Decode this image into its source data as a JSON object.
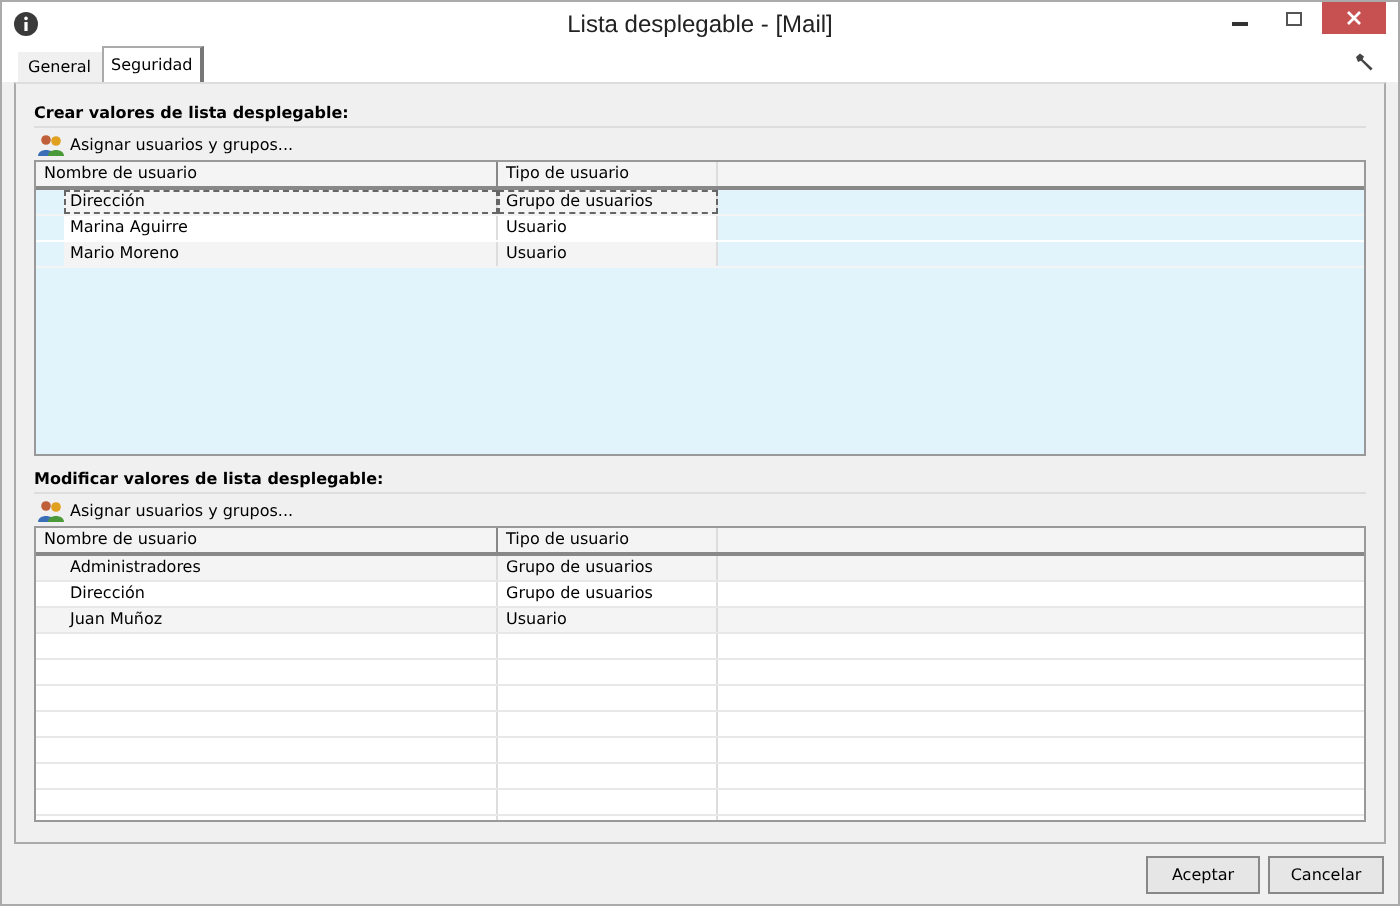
{
  "window": {
    "title": "Lista desplegable - [Mail]"
  },
  "tabs": [
    {
      "label": "General",
      "selected": false
    },
    {
      "label": "Seguridad",
      "selected": true
    }
  ],
  "sections": [
    {
      "heading": "Crear valores de lista desplegable:",
      "assign_button": "Asignar usuarios y grupos...",
      "selected": true,
      "columns": [
        "Nombre de usuario",
        "Tipo de usuario"
      ],
      "rows": [
        {
          "name": "Dirección",
          "type": "Grupo de usuarios",
          "focused": true
        },
        {
          "name": "Marina Aguirre",
          "type": "Usuario",
          "focused": false
        },
        {
          "name": "Mario Moreno",
          "type": "Usuario",
          "focused": false
        }
      ]
    },
    {
      "heading": "Modificar valores de lista desplegable:",
      "assign_button": "Asignar usuarios y grupos...",
      "selected": false,
      "columns": [
        "Nombre de usuario",
        "Tipo de usuario"
      ],
      "rows": [
        {
          "name": "Administradores",
          "type": "Grupo de usuarios",
          "focused": false
        },
        {
          "name": "Dirección",
          "type": "Grupo de usuarios",
          "focused": false
        },
        {
          "name": "Juan Muñoz",
          "type": "Usuario",
          "focused": false
        }
      ]
    }
  ],
  "buttons": [
    "Aceptar",
    "Cancelar"
  ]
}
